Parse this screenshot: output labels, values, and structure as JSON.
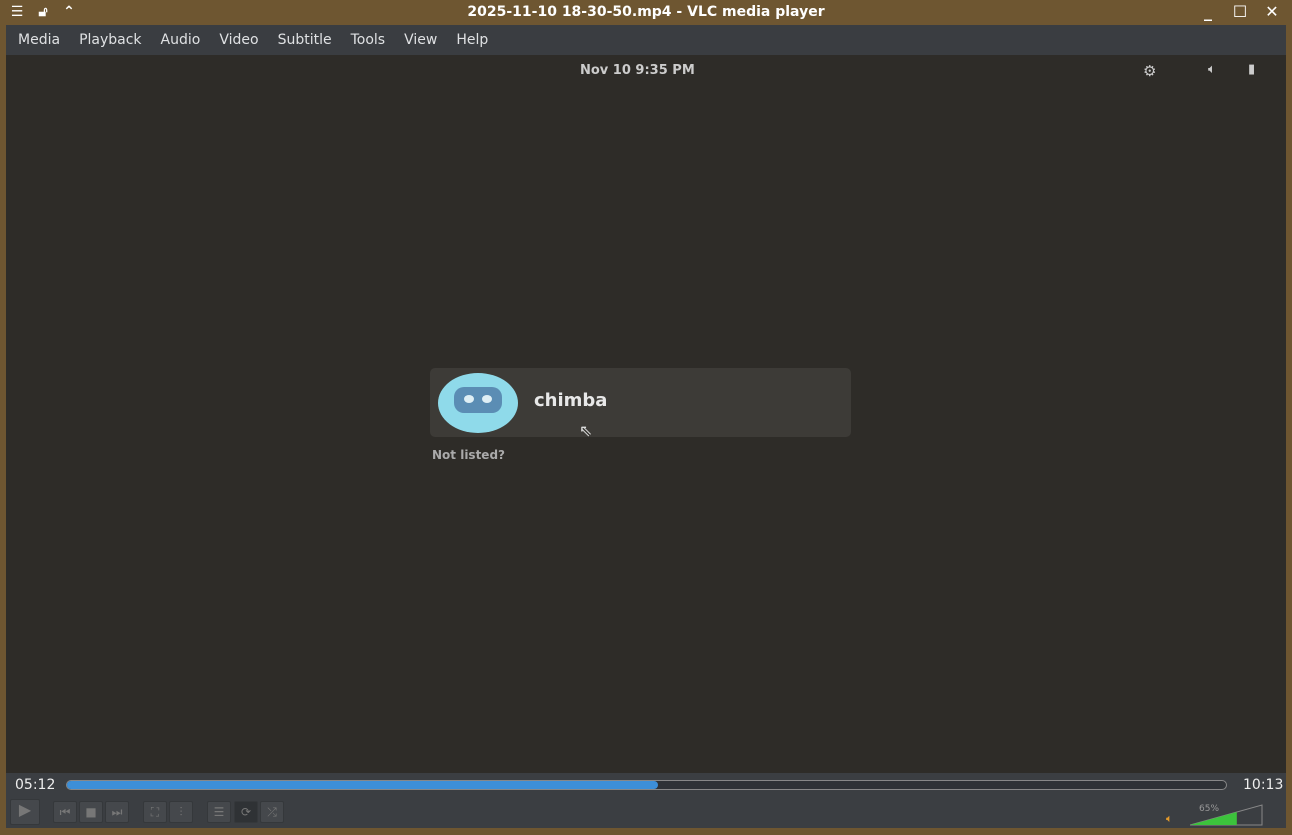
{
  "window": {
    "title": "2025-11-10 18-30-50.mp4 - VLC media player"
  },
  "menu": [
    "Media",
    "Playback",
    "Audio",
    "Video",
    "Subtitle",
    "Tools",
    "View",
    "Help"
  ],
  "video": {
    "clock": "Nov 10   9:35 PM",
    "user": "chimba",
    "not_listed": "Not listed?"
  },
  "player": {
    "elapsed": "05:12",
    "total": "10:13",
    "progress": 0.51,
    "volume_label": "65%",
    "volume": 0.65
  }
}
